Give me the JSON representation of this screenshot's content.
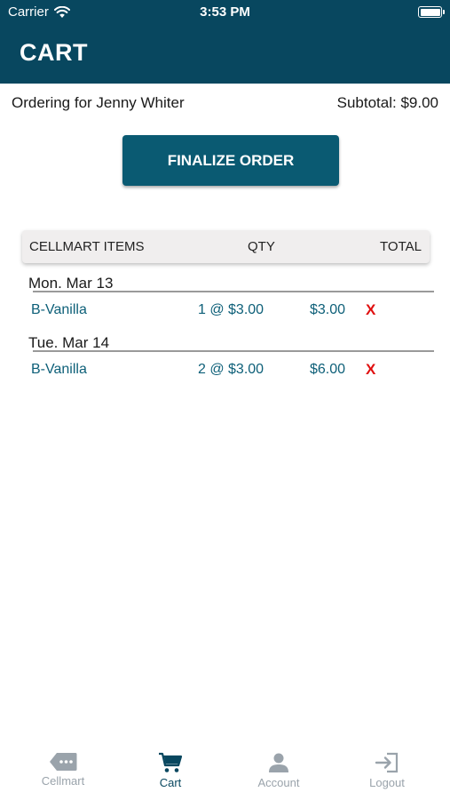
{
  "status_bar": {
    "carrier": "Carrier",
    "time": "3:53 PM",
    "icons": [
      "wifi-icon",
      "battery-icon"
    ]
  },
  "header": {
    "title": "CART"
  },
  "order": {
    "ordering_for": "Ordering for Jenny Whiter",
    "subtotal": "Subtotal: $9.00"
  },
  "finalize_button": {
    "label": "FINALIZE ORDER"
  },
  "table": {
    "headers": {
      "items": "CELLMART ITEMS",
      "qty": "QTY",
      "total": "TOTAL"
    },
    "days": [
      {
        "date": "Mon. Mar 13",
        "items": [
          {
            "name": "B-Vanilla",
            "qty": "1 @ $3.00",
            "total": "$3.00",
            "remove": "X"
          }
        ]
      },
      {
        "date": "Tue. Mar 14",
        "items": [
          {
            "name": "B-Vanilla",
            "qty": "2 @ $3.00",
            "total": "$6.00",
            "remove": "X"
          }
        ]
      }
    ]
  },
  "tabbar": {
    "tabs": [
      {
        "label": "Cellmart",
        "icon": "tag-icon",
        "active": false
      },
      {
        "label": "Cart",
        "icon": "cart-icon",
        "active": true
      },
      {
        "label": "Account",
        "icon": "person-icon",
        "active": false
      },
      {
        "label": "Logout",
        "icon": "logout-icon",
        "active": false
      }
    ]
  },
  "colors": {
    "header_bg": "#08475f",
    "button_bg": "#0a5a72",
    "item_text": "#0d5f78",
    "remove": "#e01010",
    "tab_inactive": "#9aa3ab"
  }
}
